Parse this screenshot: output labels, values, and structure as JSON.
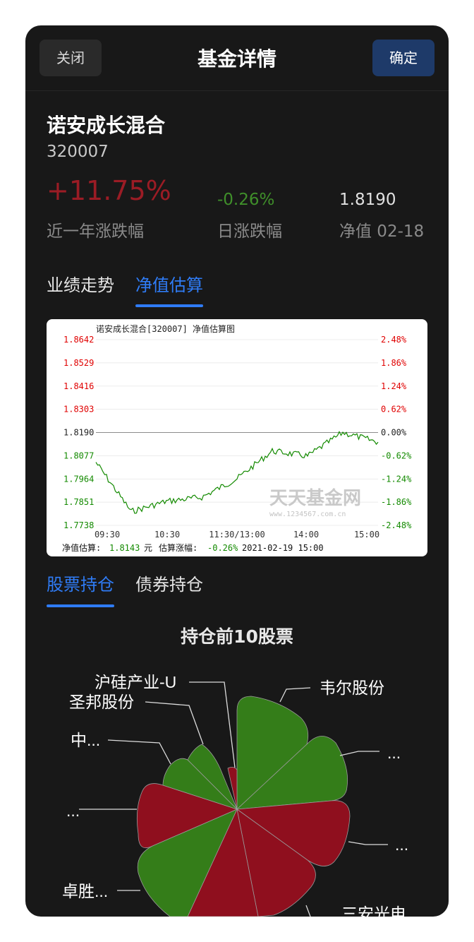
{
  "header": {
    "title": "基金详情",
    "close_label": "关闭",
    "confirm_label": "确定"
  },
  "fund": {
    "name": "诺安成长混合",
    "code": "320007",
    "year_change": "+11.75%",
    "year_change_label": "近一年涨跌幅",
    "daily_change": "-0.26%",
    "daily_change_label": "日涨跌幅",
    "nav": "1.8190",
    "nav_label": "净值 02-18"
  },
  "tabs_top": [
    "业绩走势",
    "净值估算"
  ],
  "tabs_top_active": 1,
  "estimate_chart": {
    "title": "诺安成长混合[320007] 净值估算图",
    "y_left_ticks": [
      "1.8642",
      "1.8529",
      "1.8416",
      "1.8303",
      "1.8190",
      "1.8077",
      "1.7964",
      "1.7851",
      "1.7738"
    ],
    "y_right_ticks": [
      "2.48%",
      "1.86%",
      "1.24%",
      "0.62%",
      "0.00%",
      "-0.62%",
      "-1.24%",
      "-1.86%",
      "-2.48%"
    ],
    "x_ticks": [
      "09:30",
      "10:30",
      "11:30/13:00",
      "14:00",
      "15:00"
    ],
    "watermark": "天天基金网",
    "watermark_url": "www.1234567.com.cn",
    "footer_label1": "净值估算:",
    "footer_value1": "1.8143",
    "footer_unit": "元",
    "footer_label2": "估算涨幅:",
    "footer_value2": "-0.26%",
    "footer_time": "2021-02-19 15:00",
    "colors": {
      "up": "#e00000",
      "down": "#138a00",
      "line": "#138a00"
    }
  },
  "chart_data": {
    "type": "line",
    "title": "诺安成长混合[320007] 净值估算图",
    "xlabel": "",
    "ylabel": "",
    "ylim": [
      1.7738,
      1.8642
    ],
    "x": [
      "09:30",
      "10:00",
      "10:30",
      "11:00",
      "11:30/13:00",
      "13:30",
      "14:00",
      "14:30",
      "15:00"
    ],
    "series": [
      {
        "values": [
          1.8045,
          1.7805,
          1.7855,
          1.7875,
          1.7965,
          1.81,
          1.8075,
          1.819,
          1.8143
        ]
      }
    ],
    "grid": true
  },
  "tabs_holdings": [
    "股票持仓",
    "债券持仓"
  ],
  "tabs_holdings_active": 0,
  "pie": {
    "title": "持仓前10股票",
    "labels": [
      "沪硅产业-U",
      "圣邦股份",
      "中...",
      "...",
      "卓胜...",
      "三安光电",
      "...",
      "...",
      "韦尔股份"
    ],
    "colors": {
      "green": "#347d19",
      "red": "#8f0f1e"
    }
  }
}
